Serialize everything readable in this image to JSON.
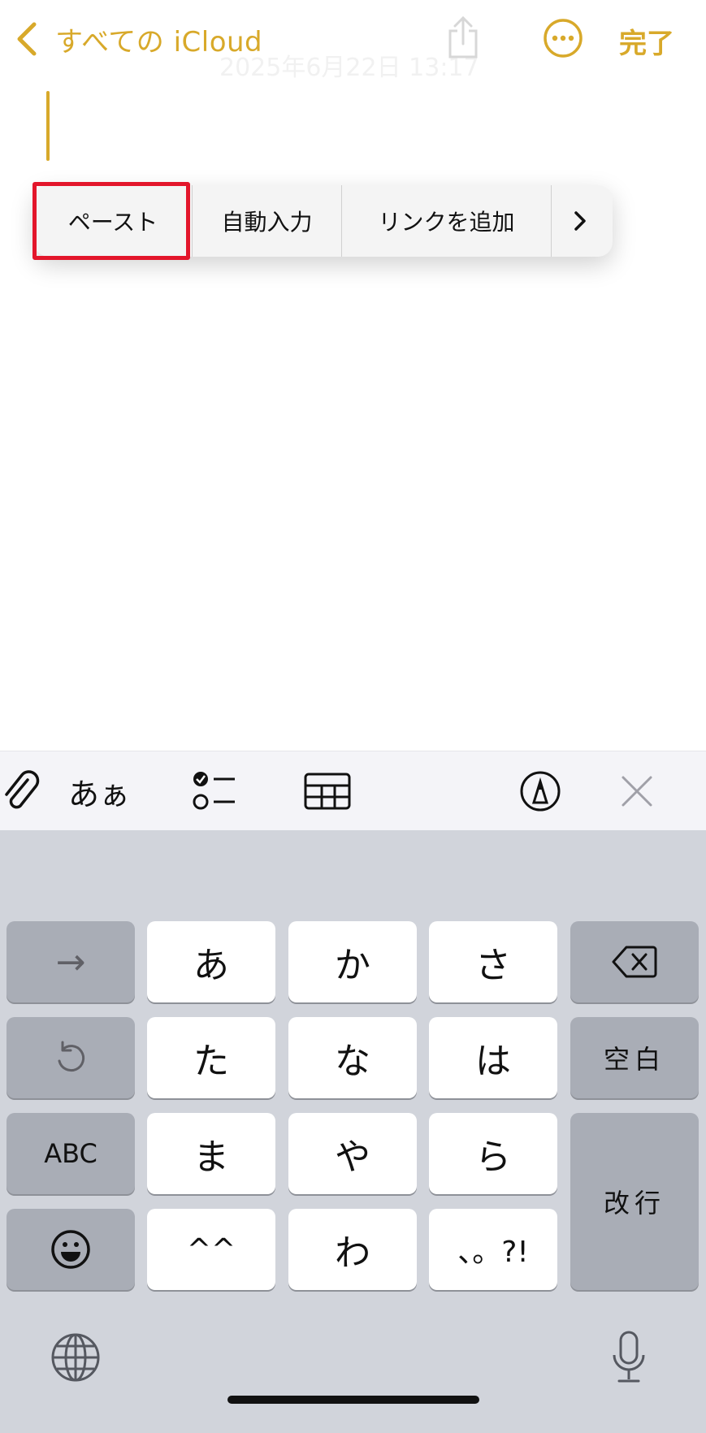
{
  "nav": {
    "back_label": "すべての iCloud",
    "done_label": "完了",
    "ghost_date": "2025年6月22日 13:17",
    "icons": [
      "chevron-left-icon",
      "share-icon",
      "more-icon"
    ]
  },
  "edit_menu": {
    "items": [
      "ペースト",
      "自動入力",
      "リンクを追加"
    ],
    "more_arrow": "›"
  },
  "toolbar": {
    "format_label": "あぁ",
    "icons": [
      "format-icon",
      "checklist-icon",
      "table-icon",
      "attachment-icon",
      "markup-icon",
      "close-icon"
    ]
  },
  "keyboard": {
    "row1": [
      "→",
      "あ",
      "か",
      "さ"
    ],
    "row2": [
      "な",
      "は",
      "た"
    ],
    "row3": [
      "ABC",
      "ま",
      "や",
      "ら"
    ],
    "row4": [
      "^^",
      "わ",
      "、。?!"
    ],
    "space_label": "空白",
    "return_label": "改行"
  },
  "colors": {
    "accent": "#d8a92a",
    "highlight_box": "#e3162b",
    "keyboard_bg": "#d1d4db",
    "key_gray": "#a9adb6"
  }
}
